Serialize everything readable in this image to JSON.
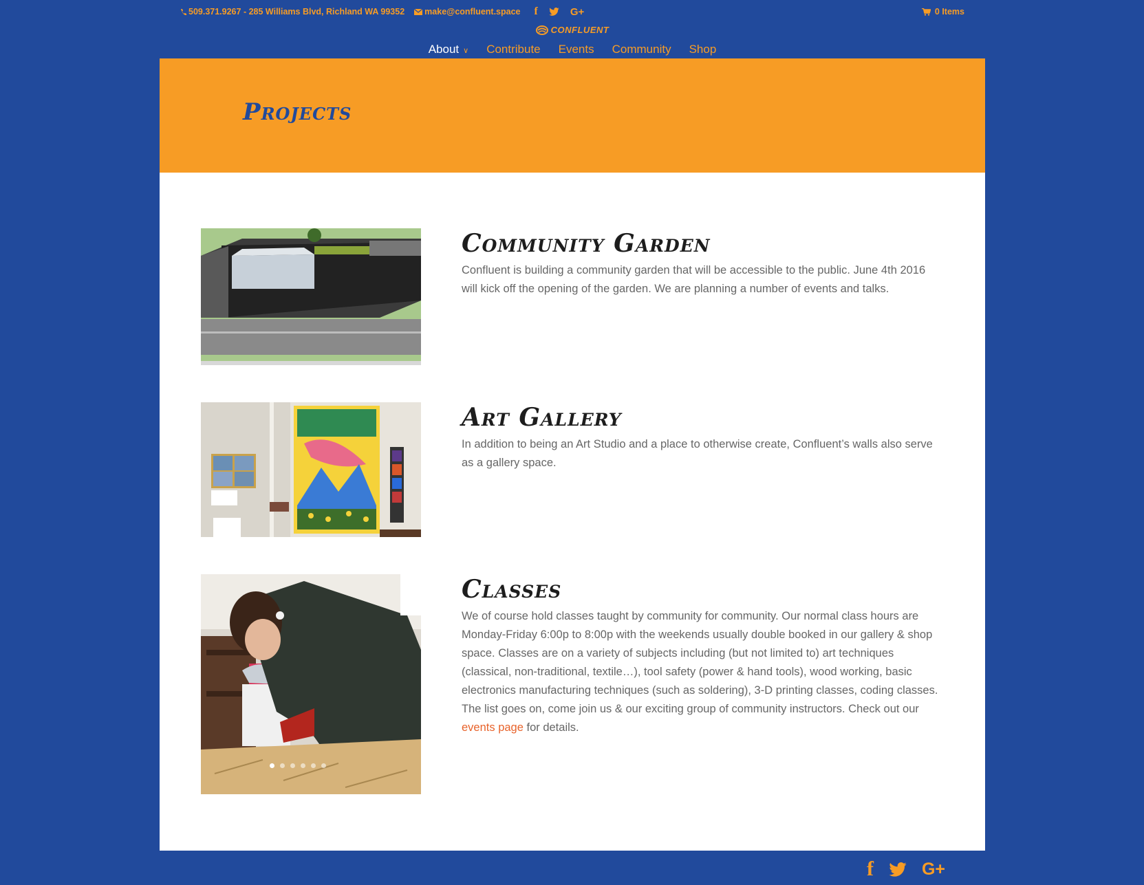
{
  "topbar": {
    "phone_address": "509.371.9267 - 285 Williams Blvd, Richland WA 99352",
    "email": "make@confluent.space",
    "social": [
      "f",
      "twitter",
      "G+"
    ],
    "cart_label": "0 Items",
    "logo_text": "CONFLUENT"
  },
  "nav": {
    "items": [
      {
        "label": "About"
      },
      {
        "label": "Contribute"
      },
      {
        "label": "Events"
      },
      {
        "label": "Community"
      },
      {
        "label": "Shop"
      }
    ]
  },
  "header": {
    "title": "Projects"
  },
  "projects": [
    {
      "title": "Community Garden",
      "description": "Confluent is building a community garden that will be accessible to the public. June 4th 2016 will kick off the opening of the garden. We are planning a number of events and talks."
    },
    {
      "title": "Art Gallery",
      "description": "In addition to being an Art Studio and a place to otherwise create, Confluent’s walls also serve as a gallery space."
    },
    {
      "title": "Classes",
      "description": "We of course hold classes taught by community for community. Our normal class hours are Monday-Friday 6:00p to 8:00p with the weekends usually double booked in our gallery & shop space. Classes are on a variety of subjects including (but not limited to) art techniques (classical, non-traditional, textile…), tool safety (power & hand tools), wood working, basic electronics manufacturing techniques (such as soldering), 3-D printing classes, coding classes. The list goes on, come join us & our exciting group of community instructors. Check out our ",
      "link_text": "events page",
      "description_end": " for details."
    }
  ],
  "footer": {
    "social_labels": [
      "f",
      "twitter",
      "G+"
    ]
  },
  "colors": {
    "blue": "#214a9c",
    "orange": "#f79c25",
    "link": "#e8632b"
  }
}
